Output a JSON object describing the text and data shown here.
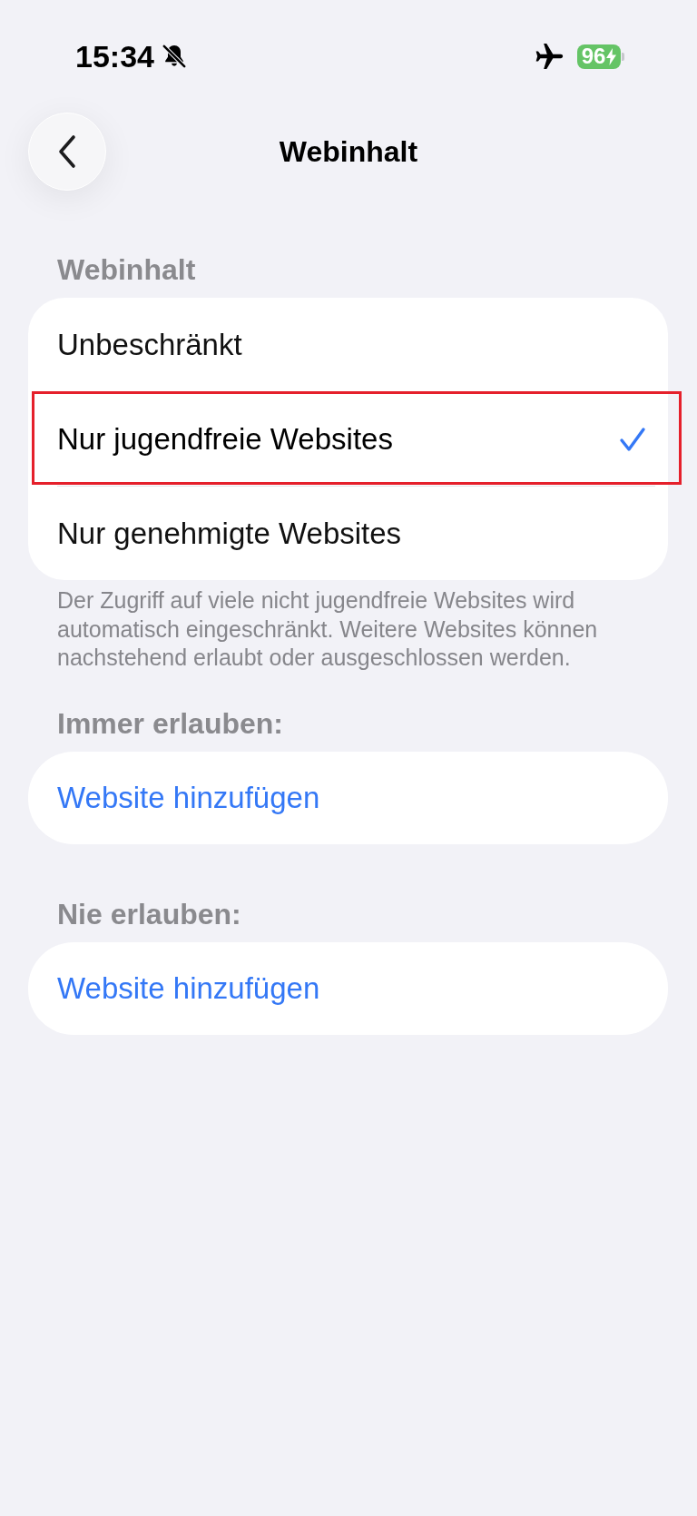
{
  "status_bar": {
    "time": "15:34",
    "silent": true,
    "airplane_mode": true,
    "battery": "96",
    "charging": true
  },
  "nav": {
    "title": "Webinhalt"
  },
  "content_section": {
    "header": "Webinhalt",
    "options": [
      {
        "label": "Unbeschränkt",
        "selected": false,
        "highlighted": false
      },
      {
        "label": "Nur jugendfreie Websites",
        "selected": true,
        "highlighted": true
      },
      {
        "label": "Nur genehmigte Websites",
        "selected": false,
        "highlighted": false
      }
    ],
    "footer": "Der Zugriff auf viele nicht jugendfreie Websites wird automatisch eingeschränkt. Weitere Websites können nachstehend erlaubt oder ausgeschlossen werden."
  },
  "allow_sections": [
    {
      "header": "Immer erlauben:",
      "action": "Website hinzufügen"
    },
    {
      "header": "Nie erlauben:",
      "action": "Website hinzufügen"
    }
  ]
}
